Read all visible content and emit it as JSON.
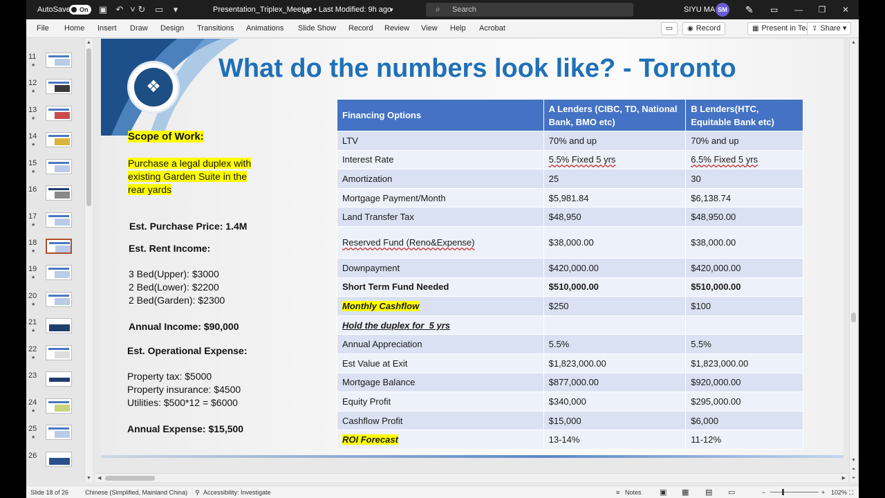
{
  "titlebar": {
    "autosave_label": "AutoSave",
    "autosave_state": "On",
    "document_title": "Presentation_Triplex_Meetup",
    "last_modified": "• Last Modified: 9h ago",
    "search_placeholder": "Search",
    "user_name": "SIYU MA",
    "user_initials": "SM",
    "window_controls": [
      "minimize-icon",
      "restore-icon",
      "close-icon"
    ]
  },
  "ribbon": {
    "tabs": [
      "File",
      "Home",
      "Insert",
      "Draw",
      "Design",
      "Transitions",
      "Animations",
      "Slide Show",
      "Record",
      "Review",
      "View",
      "Help",
      "Acrobat"
    ],
    "record_button": "Record",
    "present_in_teams": "Present in Teams",
    "share": "Share"
  },
  "thumbnails": {
    "slides": [
      "11",
      "12",
      "13",
      "14",
      "15",
      "16",
      "17",
      "18",
      "19",
      "20",
      "21",
      "22",
      "23",
      "24",
      "25",
      "26"
    ],
    "selected": "18"
  },
  "slide": {
    "title": "What do the numbers look like? - Toronto",
    "left_column": {
      "scope_heading": "Scope of Work:",
      "scope_lines": [
        "Purchase a legal duplex with",
        "existing Garden Suite in the",
        "rear yards"
      ],
      "purchase_price": "Est. Purchase Price: 1.4M",
      "rent_heading": "Est. Rent Income:",
      "rent_lines": [
        "3 Bed(Upper): $3000",
        "2 Bed(Lower): $2200",
        "2 Bed(Garden): $2300"
      ],
      "annual_income": "Annual Income: $90,000",
      "expense_heading": "Est. Operational Expense:",
      "expense_lines": [
        "Property tax: $5000",
        "Property insurance: $4500",
        "Utilities: $500*12 = $6000"
      ],
      "annual_expense": "Annual Expense: $15,500"
    },
    "table": {
      "headers": [
        "Financing Options",
        "A Lenders (CIBC, TD, National Bank, BMO etc)",
        "B Lenders(HTC, Equitable Bank etc)"
      ],
      "rows": [
        [
          "LTV",
          "70% and up",
          "70% and up"
        ],
        [
          "Interest Rate",
          "5.5% Fixed 5 yrs",
          "6.5% Fixed 5 yrs"
        ],
        [
          "Amortization",
          "25",
          "30"
        ],
        [
          "Mortgage Payment/Month",
          "$5,981.84",
          "$6,138.74"
        ],
        [
          "Land Transfer Tax",
          "$48,950",
          "$48,950.00"
        ],
        [
          "Reserved Fund (Reno&Expense)",
          "$38,000.00",
          "$38,000.00"
        ],
        [
          "Downpayment",
          "$420,000.00",
          "$420,000.00"
        ],
        [
          "Short Term Fund Needed",
          "$510,000.00",
          "$510,000.00"
        ],
        [
          "Monthly Cashflow",
          "$250",
          "$100"
        ],
        [
          "Hold the duplex for  5 yrs",
          "",
          ""
        ],
        [
          "Annual Appreciation",
          "5.5%",
          "5.5%"
        ],
        [
          "Est Value at Exit",
          "$1,823,000.00",
          "$1,823,000.00"
        ],
        [
          "Mortgage Balance",
          "$877,000.00",
          "$920,000.00"
        ],
        [
          "Equity Profit",
          "$340,000",
          "$295,000.00"
        ],
        [
          "Cashflow Profit",
          "$15,000",
          "$6,000"
        ],
        [
          "ROI Forecast",
          "13-14%",
          "11-12%"
        ]
      ]
    }
  },
  "statusbar": {
    "slide_indicator": "Slide 18 of 26",
    "language": "Chinese (Simplified, Mainland China)",
    "accessibility": "Accessibility: Investigate",
    "notes": "Notes",
    "zoom": "102%"
  },
  "colors": {
    "title_blue": "#1f70b8",
    "table_header": "#4472c4",
    "row_band": "#d9e1f2",
    "highlight": "#ffff00"
  }
}
